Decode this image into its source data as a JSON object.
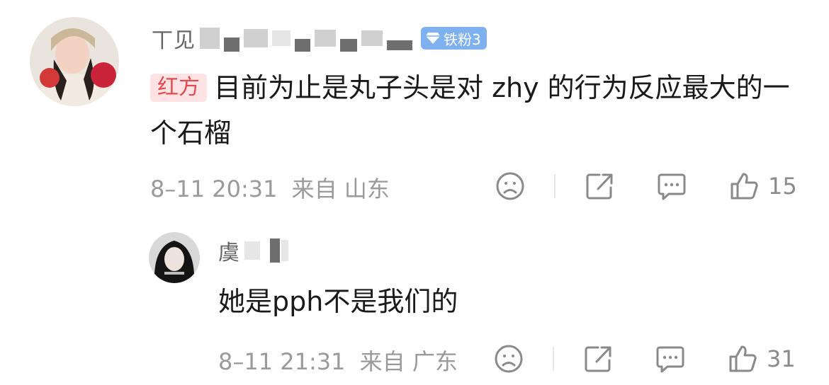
{
  "comments": [
    {
      "user_name_visible": "丅见",
      "fan_badge": "铁粉3",
      "tag": "红方",
      "text": "目前为止是丸子头是对 zhy 的行为反应最大的一个石榴",
      "time": "8–11 20:31",
      "location_label": "来自 山东",
      "likes": "15"
    },
    {
      "user_name_visible": "虞",
      "text": "她是pph不是我们的",
      "time": "8–11 21:31",
      "location_label": "来自 广东",
      "likes": "31"
    }
  ],
  "icons": {
    "dislike": "sad-face-icon",
    "share": "share-icon",
    "reply": "comment-bubble-icon",
    "like": "thumbs-up-icon",
    "fan": "diamond-icon"
  },
  "colors": {
    "tag_bg": "#fde3e3",
    "tag_text": "#e5484d",
    "badge_bg": "#7fb0ef",
    "meta_text": "#9a9a9a"
  }
}
